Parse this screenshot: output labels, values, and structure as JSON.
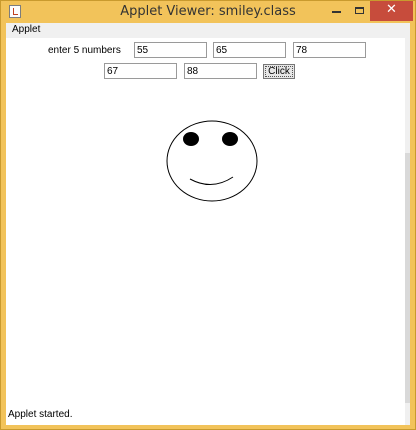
{
  "window": {
    "title": "Applet Viewer: smiley.class",
    "icon": "java-applet-icon",
    "minimize_icon": "minimize-icon",
    "maximize_icon": "maximize-icon",
    "close_icon": "close-icon",
    "close_glyph": "✕",
    "accent_color": "#f2c35a",
    "close_color": "#c74c3c"
  },
  "menu": {
    "applet_label": "Applet"
  },
  "form": {
    "prompt": "enter 5 numbers",
    "inputs": [
      "55",
      "65",
      "78",
      "67",
      "88"
    ],
    "button_label": "Click"
  },
  "drawing": {
    "shape": "smiley-face"
  },
  "status": {
    "text": "Applet started."
  }
}
